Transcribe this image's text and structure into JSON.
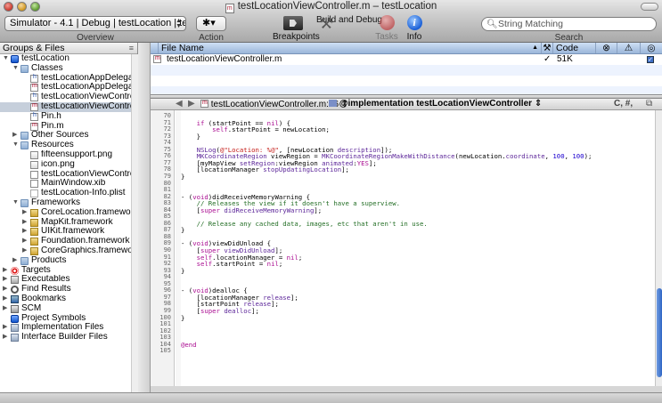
{
  "window": {
    "title": "testLocationViewController.m – testLocation"
  },
  "toolbar": {
    "overview_value": "Simulator - 4.1 | Debug | testLocation | tes...",
    "overview_label": "Overview",
    "action_label": "Action",
    "action_glyph": "✱▾",
    "breakpoints_label": "Breakpoints",
    "build_label": "Build and Debug",
    "tasks_label": "Tasks",
    "info_label": "Info",
    "search_placeholder": "String Matching",
    "search_label": "Search"
  },
  "sidebar": {
    "header": "Groups & Files",
    "rows": [
      {
        "label": "testLocation",
        "indent": 0,
        "icon": "project",
        "tri": "▼"
      },
      {
        "label": "Classes",
        "indent": 1,
        "icon": "folder",
        "tri": "▼"
      },
      {
        "label": "testLocationAppDelegate.h",
        "indent": 2,
        "icon": "file-h"
      },
      {
        "label": "testLocationAppDelegate.m",
        "indent": 2,
        "icon": "file-m"
      },
      {
        "label": "testLocationViewController.h",
        "indent": 2,
        "icon": "file-h"
      },
      {
        "label": "testLocationViewController.m",
        "indent": 2,
        "icon": "file-m",
        "selected": true
      },
      {
        "label": "Pin.h",
        "indent": 2,
        "icon": "file-h"
      },
      {
        "label": "Pin.m",
        "indent": 2,
        "icon": "file-m"
      },
      {
        "label": "Other Sources",
        "indent": 1,
        "icon": "folder",
        "tri": "▶"
      },
      {
        "label": "Resources",
        "indent": 1,
        "icon": "folder",
        "tri": "▼"
      },
      {
        "label": "fifteensupport.png",
        "indent": 2,
        "icon": "file-png"
      },
      {
        "label": "icon.png",
        "indent": 2,
        "icon": "file-png"
      },
      {
        "label": "testLocationViewController.xib",
        "indent": 2,
        "icon": "file-xib"
      },
      {
        "label": "MainWindow.xib",
        "indent": 2,
        "icon": "file-xib"
      },
      {
        "label": "testLocation-Info.plist",
        "indent": 2,
        "icon": "file-plist"
      },
      {
        "label": "Frameworks",
        "indent": 1,
        "icon": "folder",
        "tri": "▼"
      },
      {
        "label": "CoreLocation.framework",
        "indent": 2,
        "icon": "framework",
        "tri": "▶"
      },
      {
        "label": "MapKit.framework",
        "indent": 2,
        "icon": "framework",
        "tri": "▶"
      },
      {
        "label": "UIKit.framework",
        "indent": 2,
        "icon": "framework",
        "tri": "▶"
      },
      {
        "label": "Foundation.framework",
        "indent": 2,
        "icon": "framework",
        "tri": "▶"
      },
      {
        "label": "CoreGraphics.framework",
        "indent": 2,
        "icon": "framework",
        "tri": "▶"
      },
      {
        "label": "Products",
        "indent": 1,
        "icon": "folder",
        "tri": "▶"
      },
      {
        "label": "Targets",
        "indent": 0,
        "icon": "target",
        "tri": "▶"
      },
      {
        "label": "Executables",
        "indent": 0,
        "icon": "exec",
        "tri": "▶"
      },
      {
        "label": "Find Results",
        "indent": 0,
        "icon": "find",
        "tri": "▶"
      },
      {
        "label": "Bookmarks",
        "indent": 0,
        "icon": "bookmark",
        "tri": "▶"
      },
      {
        "label": "SCM",
        "indent": 0,
        "icon": "scm",
        "tri": "▶"
      },
      {
        "label": "Project Symbols",
        "indent": 0,
        "icon": "symbols"
      },
      {
        "label": "Implementation Files",
        "indent": 0,
        "icon": "smart",
        "tri": "▶"
      },
      {
        "label": "Interface Builder Files",
        "indent": 0,
        "icon": "smart",
        "tri": "▶"
      }
    ]
  },
  "detail": {
    "columns": {
      "file_name": "File Name",
      "code": "Code"
    },
    "rows": [
      {
        "file_name": "testLocationViewController.m",
        "code": "51K",
        "check": "✓"
      }
    ]
  },
  "editor": {
    "nav_file": "testLocationViewController.m:16",
    "nav_symbol": "@implementation testLocationViewController",
    "nav_right": "C, #,",
    "lines": [
      {
        "n": "70",
        "t": []
      },
      {
        "n": "71",
        "t": [
          [
            "pl",
            "    "
          ],
          [
            "kw",
            "if"
          ],
          [
            "pl",
            " (startPoint == "
          ],
          [
            "kw",
            "nil"
          ],
          [
            "pl",
            ") {"
          ]
        ]
      },
      {
        "n": "72",
        "t": [
          [
            "pl",
            "        "
          ],
          [
            "kw",
            "self"
          ],
          [
            "pl",
            ".startPoint = newLocation;"
          ]
        ]
      },
      {
        "n": "73",
        "t": [
          [
            "pl",
            "    }"
          ]
        ]
      },
      {
        "n": "74",
        "t": []
      },
      {
        "n": "75",
        "t": [
          [
            "pl",
            "    "
          ],
          [
            "cls",
            "NSLog"
          ],
          [
            "pl",
            "("
          ],
          [
            "st",
            "@\"Location: %@\""
          ],
          [
            "pl",
            ", [newLocation "
          ],
          [
            "cls",
            "description"
          ],
          [
            "pl",
            "]);"
          ]
        ]
      },
      {
        "n": "76",
        "t": [
          [
            "pl",
            "    "
          ],
          [
            "cls",
            "MKCoordinateRegion"
          ],
          [
            "pl",
            " viewRegion = "
          ],
          [
            "cls",
            "MKCoordinateRegionMakeWithDistance"
          ],
          [
            "pl",
            "(newLocation."
          ],
          [
            "cls",
            "coordinate"
          ],
          [
            "pl",
            ", "
          ],
          [
            "nm",
            "100"
          ],
          [
            "pl",
            ", "
          ],
          [
            "nm",
            "100"
          ],
          [
            "pl",
            ");"
          ]
        ]
      },
      {
        "n": "77",
        "t": [
          [
            "pl",
            "    [myMapView "
          ],
          [
            "cls",
            "setRegion"
          ],
          [
            "pl",
            ":viewRegion "
          ],
          [
            "cls",
            "animated"
          ],
          [
            "pl",
            ":"
          ],
          [
            "kw",
            "YES"
          ],
          [
            "pl",
            "];"
          ]
        ]
      },
      {
        "n": "78",
        "t": [
          [
            "pl",
            "    [locationManager "
          ],
          [
            "cls",
            "stopUpdatingLocation"
          ],
          [
            "pl",
            "];"
          ]
        ]
      },
      {
        "n": "79",
        "t": [
          [
            "pl",
            "}"
          ]
        ]
      },
      {
        "n": "80",
        "t": []
      },
      {
        "n": "81",
        "t": []
      },
      {
        "n": "82",
        "t": [
          [
            "pl",
            "- ("
          ],
          [
            "kw",
            "void"
          ],
          [
            "pl",
            ")didReceiveMemoryWarning {"
          ]
        ]
      },
      {
        "n": "83",
        "t": [
          [
            "cm",
            "    // Releases the view if it doesn't have a superview."
          ]
        ]
      },
      {
        "n": "84",
        "t": [
          [
            "pl",
            "    ["
          ],
          [
            "kw",
            "super"
          ],
          [
            "pl",
            " "
          ],
          [
            "cls",
            "didReceiveMemoryWarning"
          ],
          [
            "pl",
            "];"
          ]
        ]
      },
      {
        "n": "85",
        "t": []
      },
      {
        "n": "86",
        "t": [
          [
            "cm",
            "    // Release any cached data, images, etc that aren't in use."
          ]
        ]
      },
      {
        "n": "87",
        "t": [
          [
            "pl",
            "}"
          ]
        ]
      },
      {
        "n": "88",
        "t": []
      },
      {
        "n": "89",
        "t": [
          [
            "pl",
            "- ("
          ],
          [
            "kw",
            "void"
          ],
          [
            "pl",
            ")viewDidUnload {"
          ]
        ]
      },
      {
        "n": "90",
        "t": [
          [
            "pl",
            "    ["
          ],
          [
            "kw",
            "super"
          ],
          [
            "pl",
            " "
          ],
          [
            "cls",
            "viewDidUnload"
          ],
          [
            "pl",
            "];"
          ]
        ]
      },
      {
        "n": "91",
        "t": [
          [
            "pl",
            "    "
          ],
          [
            "kw",
            "self"
          ],
          [
            "pl",
            ".locationManager = "
          ],
          [
            "kw",
            "nil"
          ],
          [
            "pl",
            ";"
          ]
        ]
      },
      {
        "n": "92",
        "t": [
          [
            "pl",
            "    "
          ],
          [
            "kw",
            "self"
          ],
          [
            "pl",
            ".startPoint = "
          ],
          [
            "kw",
            "nil"
          ],
          [
            "pl",
            ";"
          ]
        ]
      },
      {
        "n": "93",
        "t": [
          [
            "pl",
            "}"
          ]
        ]
      },
      {
        "n": "94",
        "t": []
      },
      {
        "n": "95",
        "t": []
      },
      {
        "n": "96",
        "t": [
          [
            "pl",
            "- ("
          ],
          [
            "kw",
            "void"
          ],
          [
            "pl",
            ")dealloc {"
          ]
        ]
      },
      {
        "n": "97",
        "t": [
          [
            "pl",
            "    [locationManager "
          ],
          [
            "cls",
            "release"
          ],
          [
            "pl",
            "];"
          ]
        ]
      },
      {
        "n": "98",
        "t": [
          [
            "pl",
            "    [startPoint "
          ],
          [
            "cls",
            "release"
          ],
          [
            "pl",
            "];"
          ]
        ]
      },
      {
        "n": "99",
        "t": [
          [
            "pl",
            "    ["
          ],
          [
            "kw",
            "super"
          ],
          [
            "pl",
            " "
          ],
          [
            "cls",
            "dealloc"
          ],
          [
            "pl",
            "];"
          ]
        ]
      },
      {
        "n": "100",
        "t": [
          [
            "pl",
            "}"
          ]
        ]
      },
      {
        "n": "101",
        "t": []
      },
      {
        "n": "102",
        "t": []
      },
      {
        "n": "103",
        "t": []
      },
      {
        "n": "104",
        "t": [
          [
            "kw",
            "@end"
          ]
        ]
      },
      {
        "n": "105",
        "t": []
      }
    ]
  }
}
